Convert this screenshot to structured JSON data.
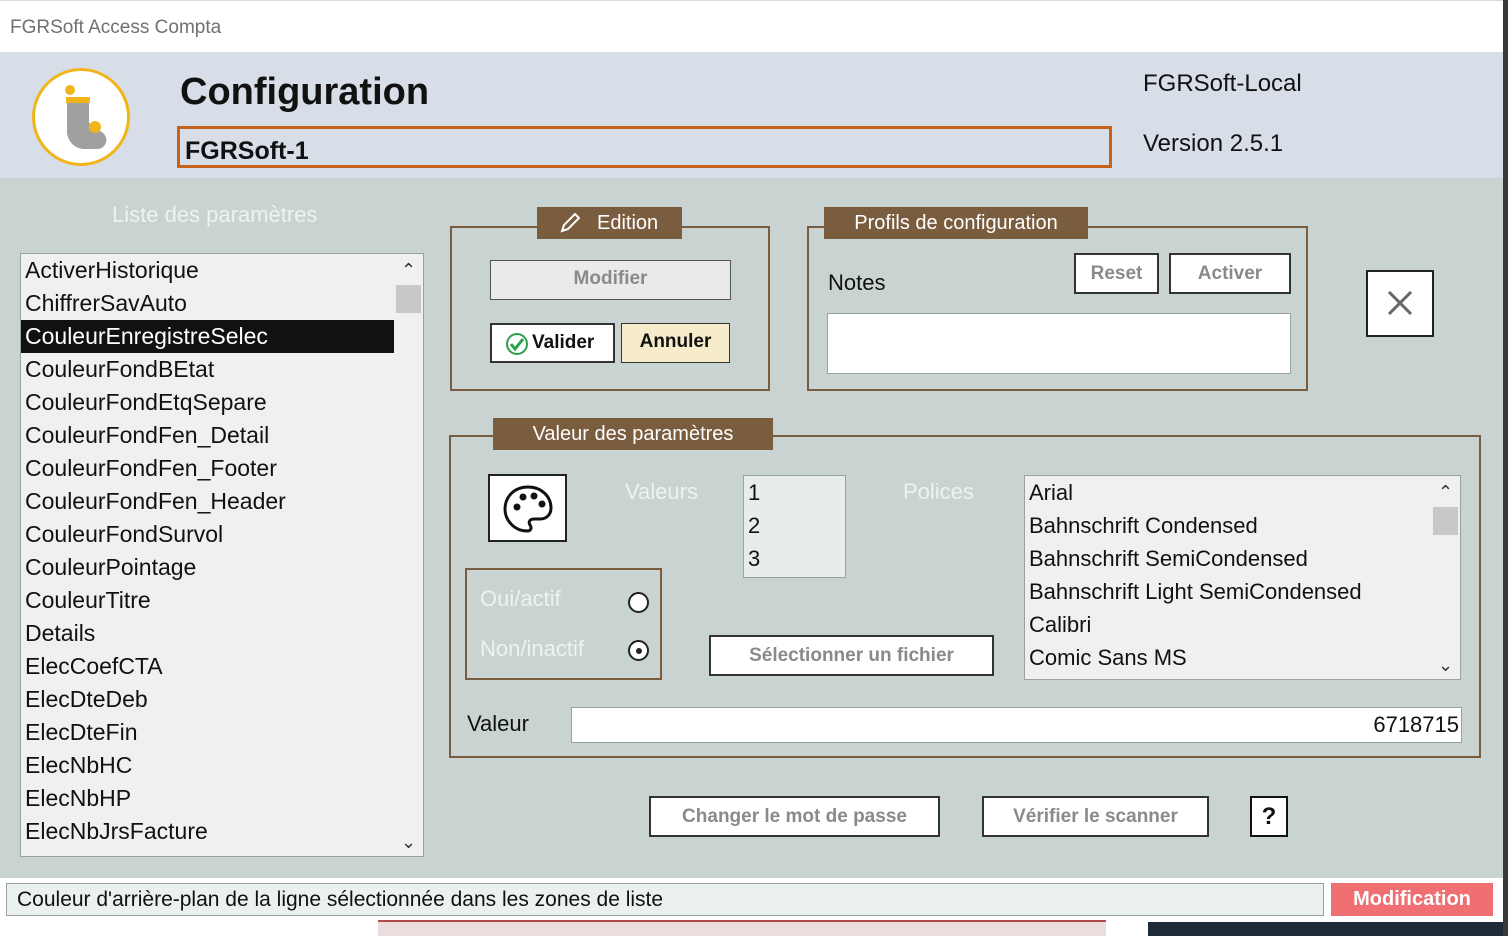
{
  "window": {
    "title": "FGRSoft Access Compta"
  },
  "header": {
    "title": "Configuration",
    "config_name": "FGRSoft-1",
    "location": "FGRSoft-Local",
    "version": "Version 2.5.1"
  },
  "params_list": {
    "title": "Liste des paramètres",
    "selected_index": 2,
    "items": [
      "ActiverHistorique",
      "ChiffrerSavAuto",
      "CouleurEnregistreSelec",
      "CouleurFondBEtat",
      "CouleurFondEtqSepare",
      "CouleurFondFen_Detail",
      "CouleurFondFen_Footer",
      "CouleurFondFen_Header",
      "CouleurFondSurvol",
      "CouleurPointage",
      "CouleurTitre",
      "Details",
      "ElecCoefCTA",
      "ElecDteDeb",
      "ElecDteFin",
      "ElecNbHC",
      "ElecNbHP",
      "ElecNbJrsFacture"
    ]
  },
  "edition": {
    "label": "Edition",
    "modify": "Modifier",
    "validate": "Valider",
    "cancel": "Annuler"
  },
  "profiles": {
    "label": "Profils de configuration",
    "notes_label": "Notes",
    "notes_value": "",
    "reset": "Reset",
    "activate": "Activer"
  },
  "values_group": {
    "label": "Valeur des paramètres",
    "values_label": "Valeurs",
    "values": [
      "1",
      "2",
      "3"
    ],
    "fonts_label": "Polices",
    "fonts": [
      "Arial",
      "Bahnschrift Condensed",
      "Bahnschrift SemiCondensed",
      "Bahnschrift Light SemiCondensed",
      "Calibri",
      "Comic Sans MS"
    ],
    "yes_label": "Oui/actif",
    "no_label": "Non/inactif",
    "select_file": "Sélectionner un fichier",
    "value_label": "Valeur",
    "value": "6718715"
  },
  "bottom": {
    "change_password": "Changer le mot de passe",
    "check_scanner": "Vérifier le scanner",
    "help": "?"
  },
  "status": {
    "text": "Couleur d'arrière-plan de la ligne sélectionnée dans les zones de liste",
    "mode": "Modification"
  },
  "colors": {
    "accent_brown": "#7a5c3e",
    "accent_orange": "#c8601e",
    "status_mode_bg": "#ef6f72"
  }
}
